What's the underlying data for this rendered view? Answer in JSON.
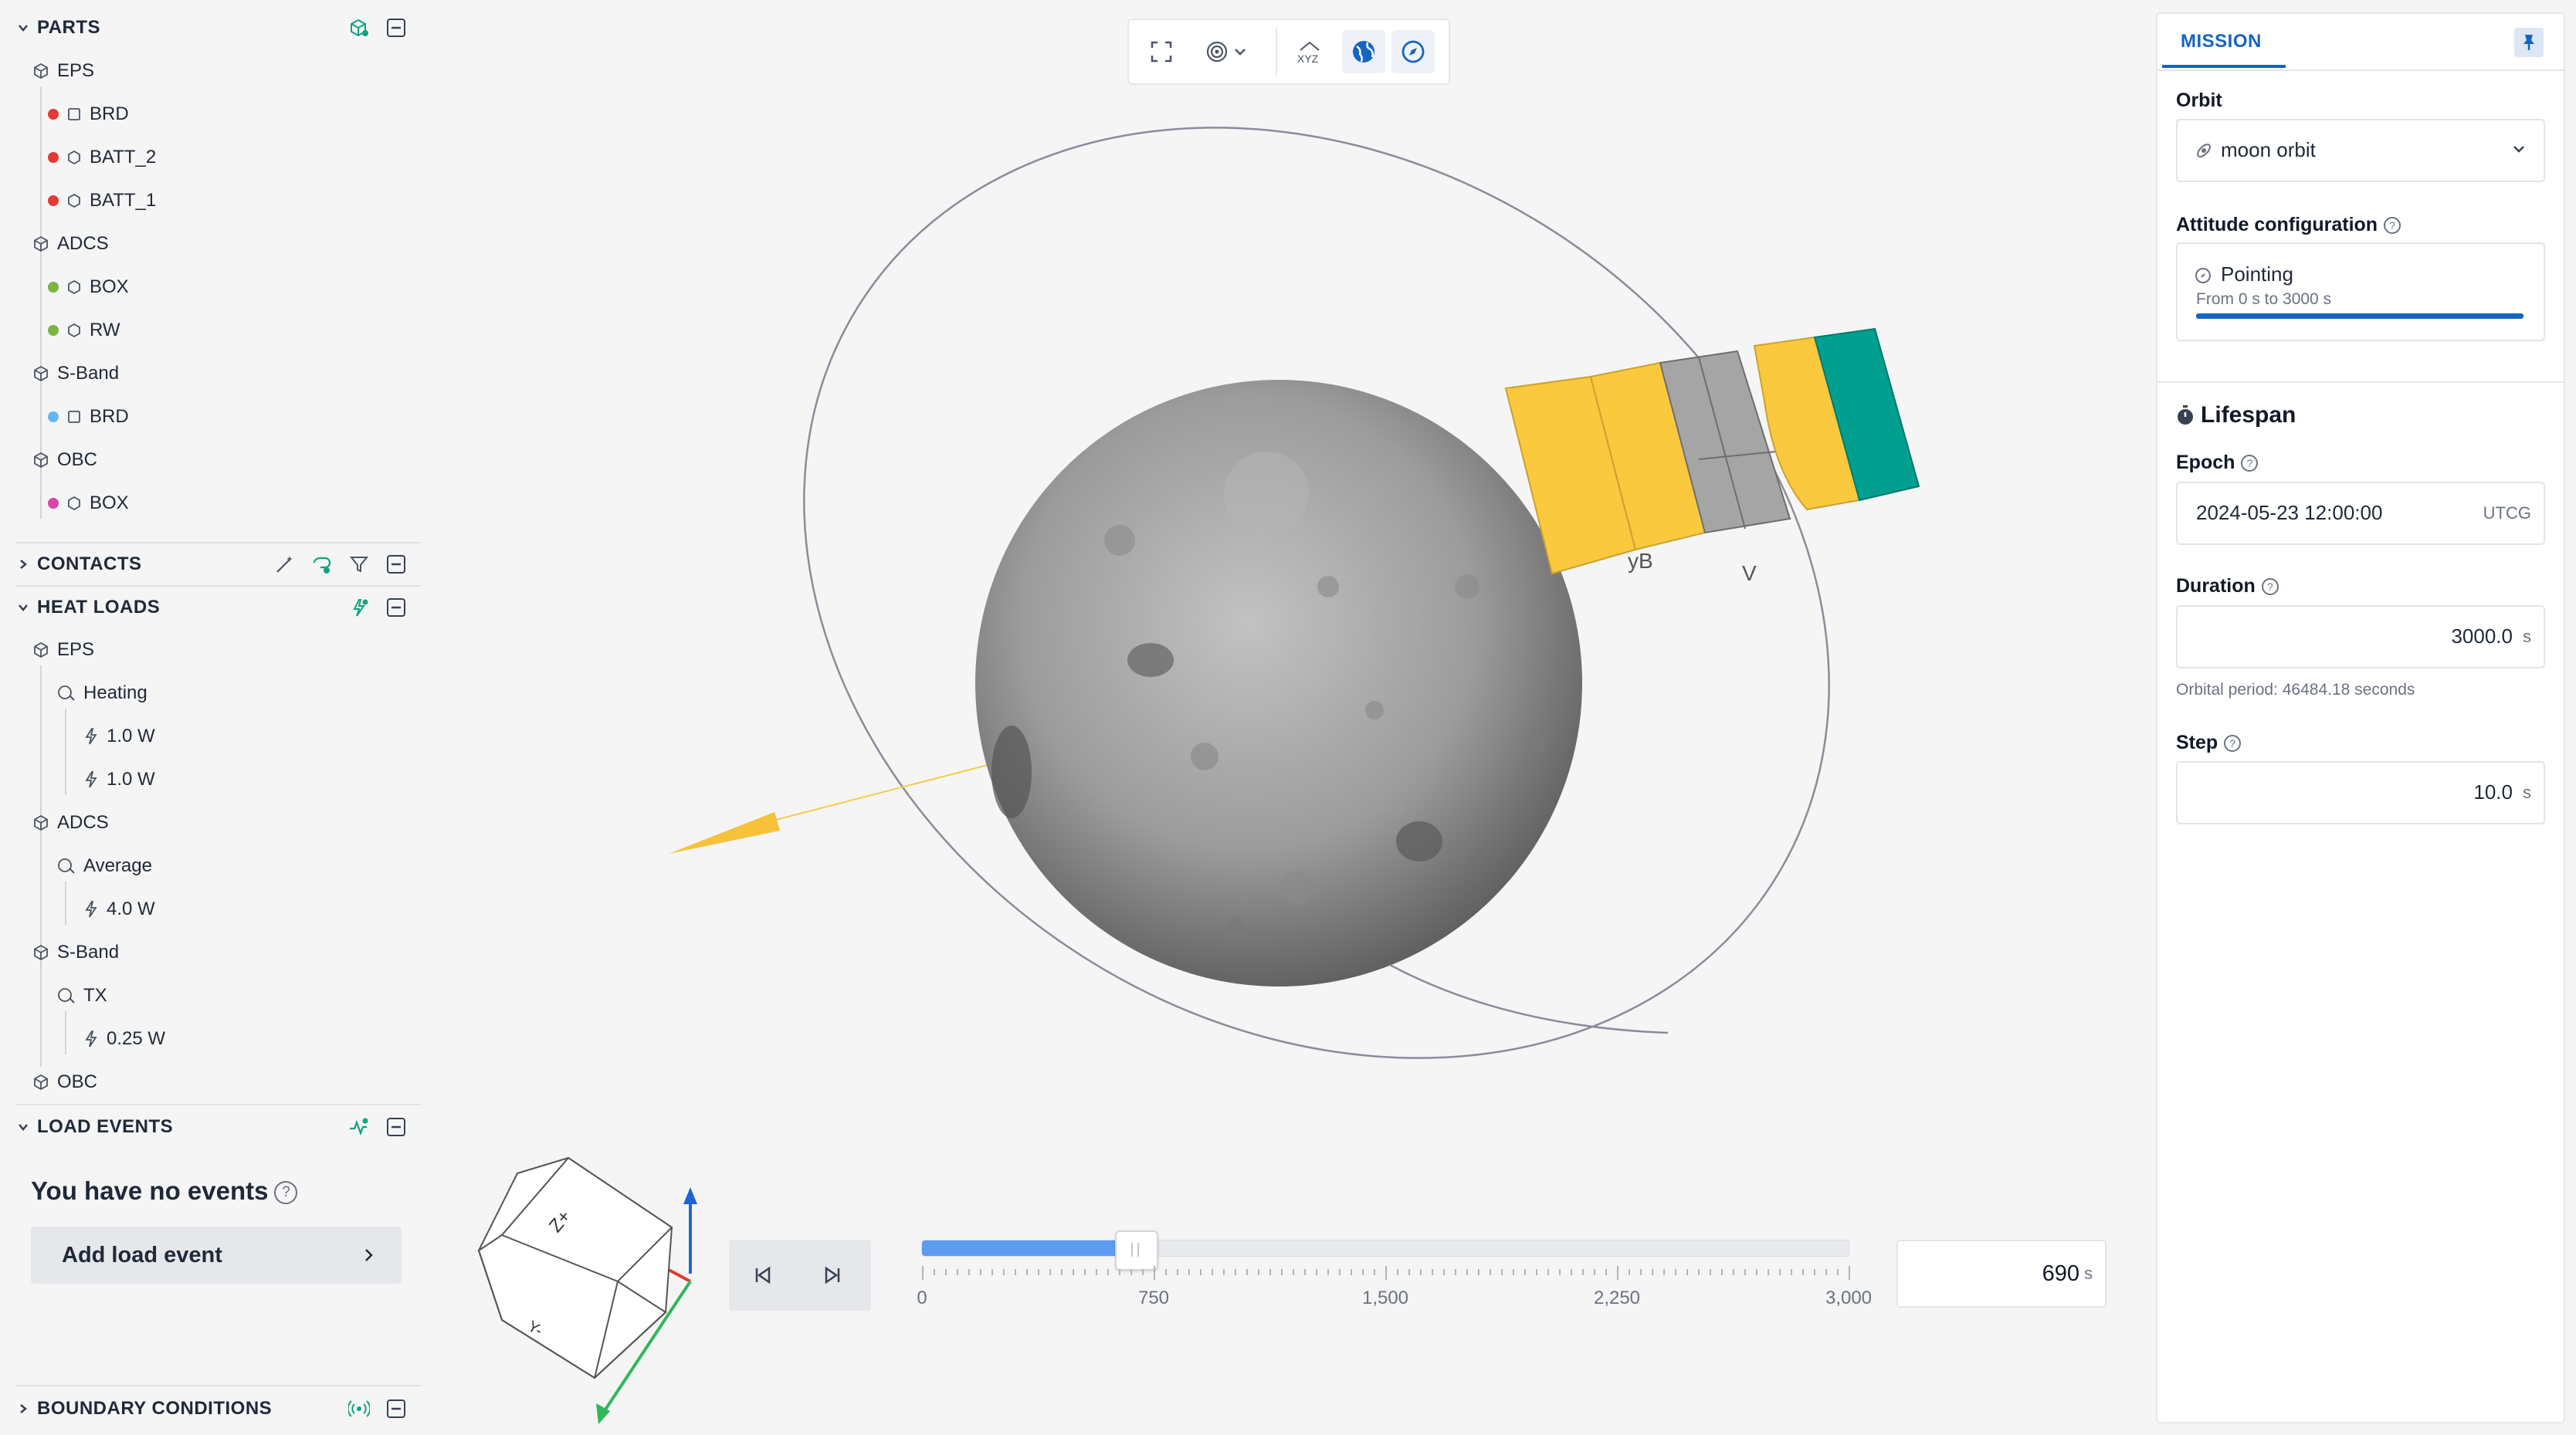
{
  "left": {
    "parts": {
      "title": "PARTS",
      "items": [
        {
          "label": "EPS"
        },
        {
          "label": "BRD",
          "color": "#e53935",
          "shape": "square"
        },
        {
          "label": "BATT_2",
          "color": "#e53935",
          "shape": "hex"
        },
        {
          "label": "BATT_1",
          "color": "#e53935",
          "shape": "hex"
        },
        {
          "label": "ADCS"
        },
        {
          "label": "BOX",
          "color": "#7cb342",
          "shape": "hex"
        },
        {
          "label": "RW",
          "color": "#7cb342",
          "shape": "hex"
        },
        {
          "label": "S-Band"
        },
        {
          "label": "BRD",
          "color": "#64b5f6",
          "shape": "square"
        },
        {
          "label": "OBC"
        },
        {
          "label": "BOX",
          "color": "#d946a8",
          "shape": "hex"
        }
      ]
    },
    "contacts": {
      "title": "CONTACTS"
    },
    "heat_loads": {
      "title": "HEAT LOADS",
      "items": [
        {
          "label": "EPS"
        },
        {
          "label": "Heating"
        },
        {
          "label": "1.0 W"
        },
        {
          "label": "1.0 W"
        },
        {
          "label": "ADCS"
        },
        {
          "label": "Average"
        },
        {
          "label": "4.0 W"
        },
        {
          "label": "S-Band"
        },
        {
          "label": "TX"
        },
        {
          "label": "0.25 W"
        },
        {
          "label": "OBC"
        }
      ]
    },
    "load_events": {
      "title": "LOAD EVENTS",
      "empty_text": "You have no events",
      "add_label": "Add load event"
    },
    "boundary": {
      "title": "BOUNDARY CONDITIONS"
    }
  },
  "viewport": {
    "axis_labels": {
      "yb": "yB",
      "v": "V"
    },
    "cube_labels": {
      "top": "Z+",
      "front": "Y-"
    }
  },
  "timeline": {
    "min": 0,
    "max": 3000,
    "value": 690,
    "ticks": [
      "0",
      "750",
      "1,500",
      "2,250",
      "3,000"
    ],
    "value_display": "690",
    "unit": "s"
  },
  "mission": {
    "tab": "MISSION",
    "orbit_label": "Orbit",
    "orbit_value": "moon orbit",
    "attitude_label": "Attitude configuration",
    "attitude_mode": "Pointing",
    "attitude_range": "From 0 s to 3000 s",
    "lifespan_title": "Lifespan",
    "epoch_label": "Epoch",
    "epoch_value": "2024-05-23 12:00:00",
    "epoch_unit": "UTCG",
    "duration_label": "Duration",
    "duration_value": "3000.0",
    "duration_unit": "s",
    "orbital_period": "Orbital period: 46484.18 seconds",
    "step_label": "Step",
    "step_value": "10.0",
    "step_unit": "s"
  },
  "colors": {
    "accent": "#1565c0",
    "slider": "#5b9bf0",
    "panel_yellow": "#fbc93d",
    "panel_teal": "#009f8f"
  }
}
